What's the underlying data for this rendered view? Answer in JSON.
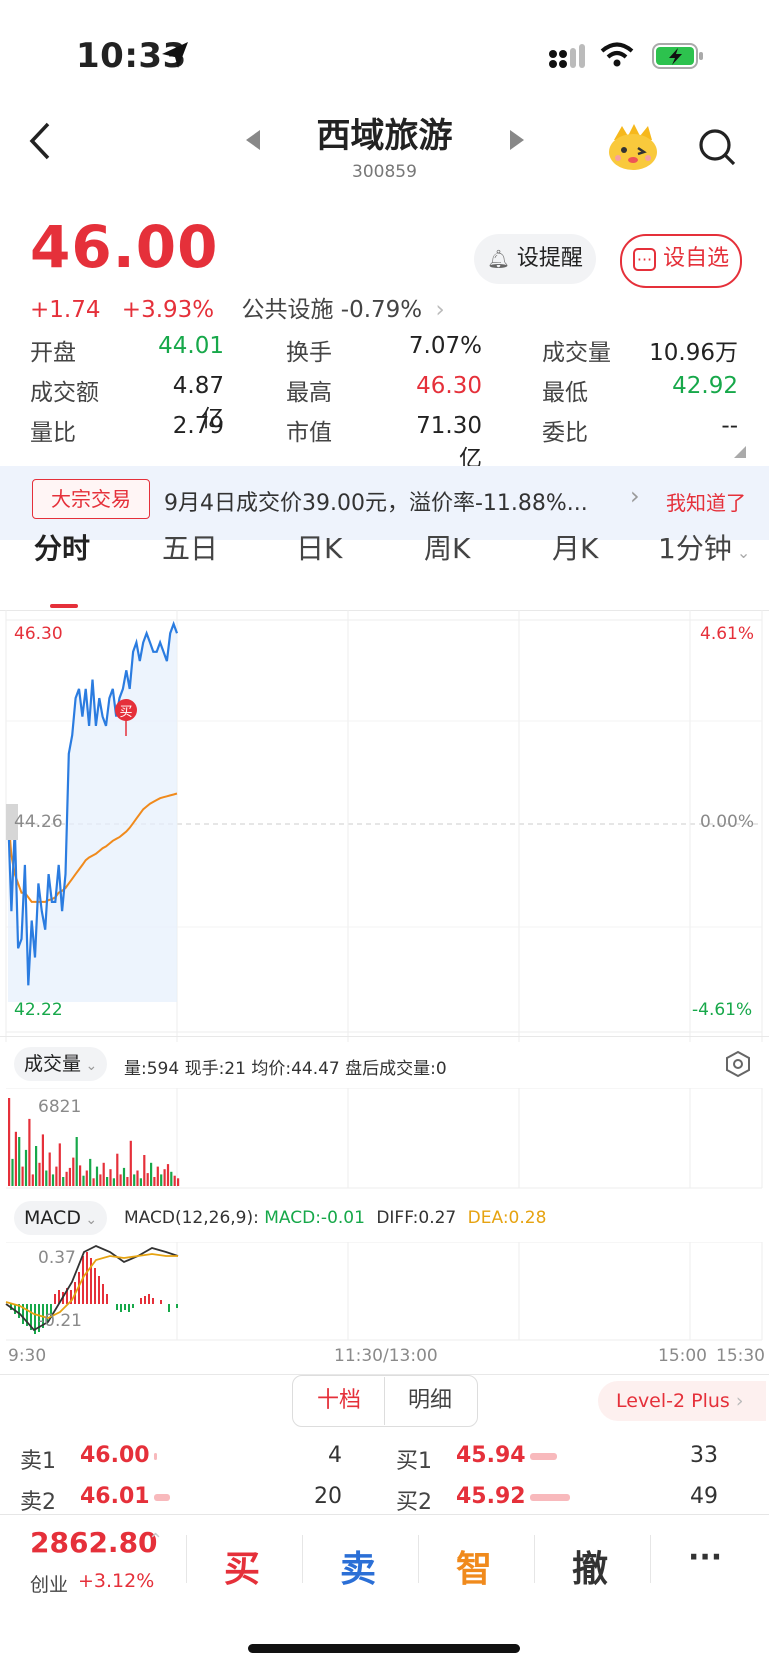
{
  "status": {
    "time": "10:33"
  },
  "header": {
    "title": "西域旅游",
    "code": "300859"
  },
  "quote": {
    "price": "46.00",
    "change": "+1.74",
    "change_pct": "+3.93%",
    "sector": "公共设施",
    "sector_pct": "-0.79%",
    "alert_btn": "设提醒",
    "watch_btn": "设自选"
  },
  "stats": [
    {
      "label": "开盘",
      "value": "44.01",
      "color": "#17a84a"
    },
    {
      "label": "换手",
      "value": "7.07%",
      "color": "#222222"
    },
    {
      "label": "成交量",
      "value": "10.96万",
      "color": "#222222"
    },
    {
      "label": "成交额",
      "value": "4.87亿",
      "color": "#222222"
    },
    {
      "label": "最高",
      "value": "46.30",
      "color": "#e5303a"
    },
    {
      "label": "最低",
      "value": "42.92",
      "color": "#17a84a"
    },
    {
      "label": "量比",
      "value": "2.79",
      "color": "#222222"
    },
    {
      "label": "市值",
      "value": "71.30亿",
      "color": "#222222"
    },
    {
      "label": "委比",
      "value": "--",
      "color": "#222222"
    }
  ],
  "notice": {
    "tag": "大宗交易",
    "text": "9月4日成交价39.00元，溢价率-11.88%...",
    "dismiss": "我知道了"
  },
  "tabs": [
    "分时",
    "五日",
    "日K",
    "周K",
    "月K",
    "1分钟"
  ],
  "chart_labels": {
    "price_high": "46.30",
    "price_mid": "44.26",
    "price_low": "42.22",
    "pct_high": "4.61%",
    "pct_mid": "0.00%",
    "pct_low": "-4.61%",
    "buy_marker": "买"
  },
  "volume_bar": {
    "selector": "成交量",
    "info": "量:594  现手:21  均价:44.47  盘后成交量:0",
    "max": "6821"
  },
  "macd_bar": {
    "selector": "MACD",
    "params": "MACD(12,26,9):",
    "macd": "MACD:-0.01",
    "diff": "DIFF:0.27",
    "dea": "DEA:0.28",
    "top": "0.37",
    "bottom": "-0.21"
  },
  "time_axis": {
    "t1": "9:30",
    "t2": "11:30/13:00",
    "t3": "15:00",
    "t4": "15:30"
  },
  "orderbook_tabs": {
    "ten": "十档",
    "detail": "明细",
    "level2": "Level-2 Plus"
  },
  "orderbook": {
    "sell": [
      {
        "label": "卖1",
        "price": "46.00",
        "vol": "4",
        "bar": 0.02
      },
      {
        "label": "卖2",
        "price": "46.01",
        "vol": "20",
        "bar": 0.1
      }
    ],
    "buy": [
      {
        "label": "买1",
        "price": "45.94",
        "vol": "33",
        "bar": 0.17
      },
      {
        "label": "买2",
        "price": "45.92",
        "vol": "49",
        "bar": 0.25
      }
    ]
  },
  "bottom": {
    "index_value": "2862.80",
    "index_name": "创业",
    "index_pct": "+3.12%",
    "buy": "买",
    "sell": "卖",
    "smart": "智",
    "cancel": "撤",
    "more": "···"
  },
  "chart_data": {
    "type": "line",
    "title": "",
    "series": [
      {
        "name": "",
        "values": [
          44.26,
          43.2,
          44.1,
          42.8,
          42.9,
          43.7,
          42.4,
          43.1,
          42.7,
          43.5,
          43.2,
          43.0,
          43.6,
          43.3,
          43.3,
          43.7,
          43.2,
          43.6,
          44.9,
          45.1,
          45.5,
          45.6,
          45.3,
          45.6,
          45.2,
          45.7,
          45.2,
          45.5,
          45.3,
          45.2,
          45.5,
          45.6,
          45.3,
          45.5,
          45.6,
          45.8,
          45.6,
          46.0,
          46.1,
          45.9,
          46.1,
          46.2,
          46.1,
          46.0,
          46.0,
          46.1,
          46.0,
          45.9,
          46.2,
          46.3,
          46.2
        ]
      },
      {
        "name": "",
        "values": [
          44.26,
          43.8,
          43.6,
          43.5,
          43.4,
          43.4,
          43.35,
          43.3,
          43.3,
          43.3,
          43.3,
          43.3,
          43.32,
          43.33,
          43.35,
          43.4,
          43.42,
          43.45,
          43.5,
          43.55,
          43.6,
          43.65,
          43.7,
          43.75,
          43.78,
          43.8,
          43.82,
          43.85,
          43.88,
          43.9,
          43.93,
          43.96,
          43.98,
          44.0,
          44.03,
          44.06,
          44.1,
          44.15,
          44.2,
          44.25,
          44.3,
          44.33,
          44.36,
          44.38,
          44.4,
          44.42,
          44.43,
          44.44,
          44.45,
          44.46,
          44.47
        ]
      }
    ],
    "ylim": [
      42.22,
      46.3
    ],
    "volume": [
      6821,
      2100,
      4200,
      3800,
      1500,
      2800,
      5200,
      900,
      3100,
      1800,
      4000,
      1200,
      2600,
      900,
      1500,
      3300,
      700,
      1100,
      1400,
      2200,
      3800,
      1600,
      800,
      1200,
      2100,
      600,
      1500,
      900,
      1800,
      700,
      1300,
      600,
      2500,
      900,
      1400,
      700,
      3500,
      900,
      1200,
      600,
      2400,
      1000,
      1800,
      700,
      1500,
      900,
      1300,
      1700,
      1100,
      800,
      600
    ],
    "volume_up": [
      1,
      0,
      1,
      0,
      1,
      0,
      1,
      1,
      0,
      1,
      1,
      0,
      1,
      0,
      1,
      1,
      0,
      1,
      1,
      1,
      0,
      1,
      0,
      1,
      0,
      1,
      0,
      1,
      1,
      0,
      1,
      0,
      1,
      1,
      0,
      1,
      1,
      0,
      1,
      0,
      1,
      1,
      0,
      1,
      1,
      0,
      1,
      1,
      0,
      1,
      1
    ]
  }
}
